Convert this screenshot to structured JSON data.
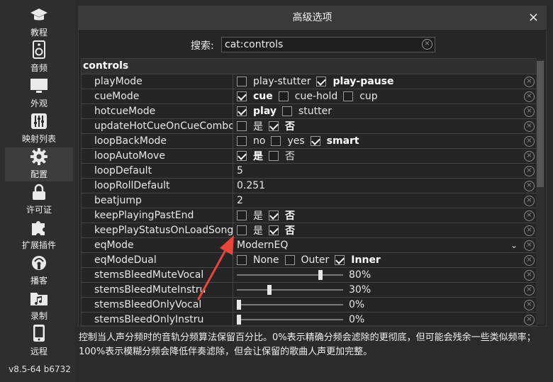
{
  "sidebar": {
    "items": [
      {
        "label": "教程",
        "icon": "graduation-cap-icon"
      },
      {
        "label": "音频",
        "icon": "speaker-icon"
      },
      {
        "label": "外观",
        "icon": "monitor-icon"
      },
      {
        "label": "映射列表",
        "icon": "sliders-icon"
      },
      {
        "label": "配置",
        "icon": "gear-icon"
      },
      {
        "label": "许可证",
        "icon": "lock-icon"
      },
      {
        "label": "扩展插件",
        "icon": "puzzle-icon"
      },
      {
        "label": "播客",
        "icon": "podcast-icon"
      },
      {
        "label": "录制",
        "icon": "music-folder-icon"
      },
      {
        "label": "远程",
        "icon": "phone-icon"
      }
    ],
    "active_index": 4,
    "version": "v8.5-64 b6732"
  },
  "dialog": {
    "title": "高级选项",
    "close": "×",
    "search_label": "搜索:",
    "search_value": "cat:controls",
    "clear_glyph": "×"
  },
  "table": {
    "section": "controls",
    "rows": [
      {
        "name": "playMode",
        "kind": "options",
        "options": [
          {
            "label": "play-stutter",
            "checked": false
          },
          {
            "label": "play-pause",
            "checked": true
          }
        ]
      },
      {
        "name": "cueMode",
        "kind": "options",
        "options": [
          {
            "label": "cue",
            "checked": true
          },
          {
            "label": "cue-hold",
            "checked": false
          },
          {
            "label": "cup",
            "checked": false
          }
        ]
      },
      {
        "name": "hotcueMode",
        "kind": "options",
        "options": [
          {
            "label": "play",
            "checked": true
          },
          {
            "label": "stutter",
            "checked": false
          }
        ]
      },
      {
        "name": "updateHotCueOnCueCombo",
        "kind": "options",
        "options": [
          {
            "label": "是",
            "checked": false
          },
          {
            "label": "否",
            "checked": true
          }
        ]
      },
      {
        "name": "loopBackMode",
        "kind": "options",
        "options": [
          {
            "label": "no",
            "checked": false
          },
          {
            "label": "yes",
            "checked": false
          },
          {
            "label": "smart",
            "checked": true
          }
        ]
      },
      {
        "name": "loopAutoMove",
        "kind": "options",
        "options": [
          {
            "label": "是",
            "checked": true
          },
          {
            "label": "否",
            "checked": false
          }
        ]
      },
      {
        "name": "loopDefault",
        "kind": "text",
        "value": "5"
      },
      {
        "name": "loopRollDefault",
        "kind": "text",
        "value": "0.251"
      },
      {
        "name": "beatjump",
        "kind": "text",
        "value": "2"
      },
      {
        "name": "keepPlayingPastEnd",
        "kind": "options",
        "options": [
          {
            "label": "是",
            "checked": false
          },
          {
            "label": "否",
            "checked": true
          }
        ]
      },
      {
        "name": "keepPlayStatusOnLoadSong",
        "kind": "options",
        "options": [
          {
            "label": "是",
            "checked": false
          },
          {
            "label": "否",
            "checked": true
          }
        ]
      },
      {
        "name": "eqMode",
        "kind": "dropdown",
        "value": "ModernEQ"
      },
      {
        "name": "eqModeDual",
        "kind": "options",
        "options": [
          {
            "label": "None",
            "checked": false
          },
          {
            "label": "Outer",
            "checked": false
          },
          {
            "label": "Inner",
            "checked": true
          }
        ]
      },
      {
        "name": "stemsBleedMuteVocal",
        "kind": "slider",
        "level": 0.8,
        "value": "80%"
      },
      {
        "name": "stemsBleedMuteInstru",
        "kind": "slider",
        "level": 0.3,
        "value": "30%"
      },
      {
        "name": "stemsBleedOnlyVocal",
        "kind": "slider",
        "level": 0.0,
        "value": "0%"
      },
      {
        "name": "stemsBleedOnlyInstru",
        "kind": "slider",
        "level": 0.0,
        "value": "0%"
      }
    ]
  },
  "help_text": "控制当人声分频时的音轨分频算法保留百分比。0%表示精确分频会滤除的更彻底，但可能会残余一些类似频率；100%表示模糊分频会降低伴奏滤除，但会让保留的歌曲人声更加完整。",
  "colors": {
    "background": "#2b2b2b",
    "panel": "#262626",
    "titlebar": "#3a3a3a",
    "annotation_arrow": "#e8453c"
  }
}
